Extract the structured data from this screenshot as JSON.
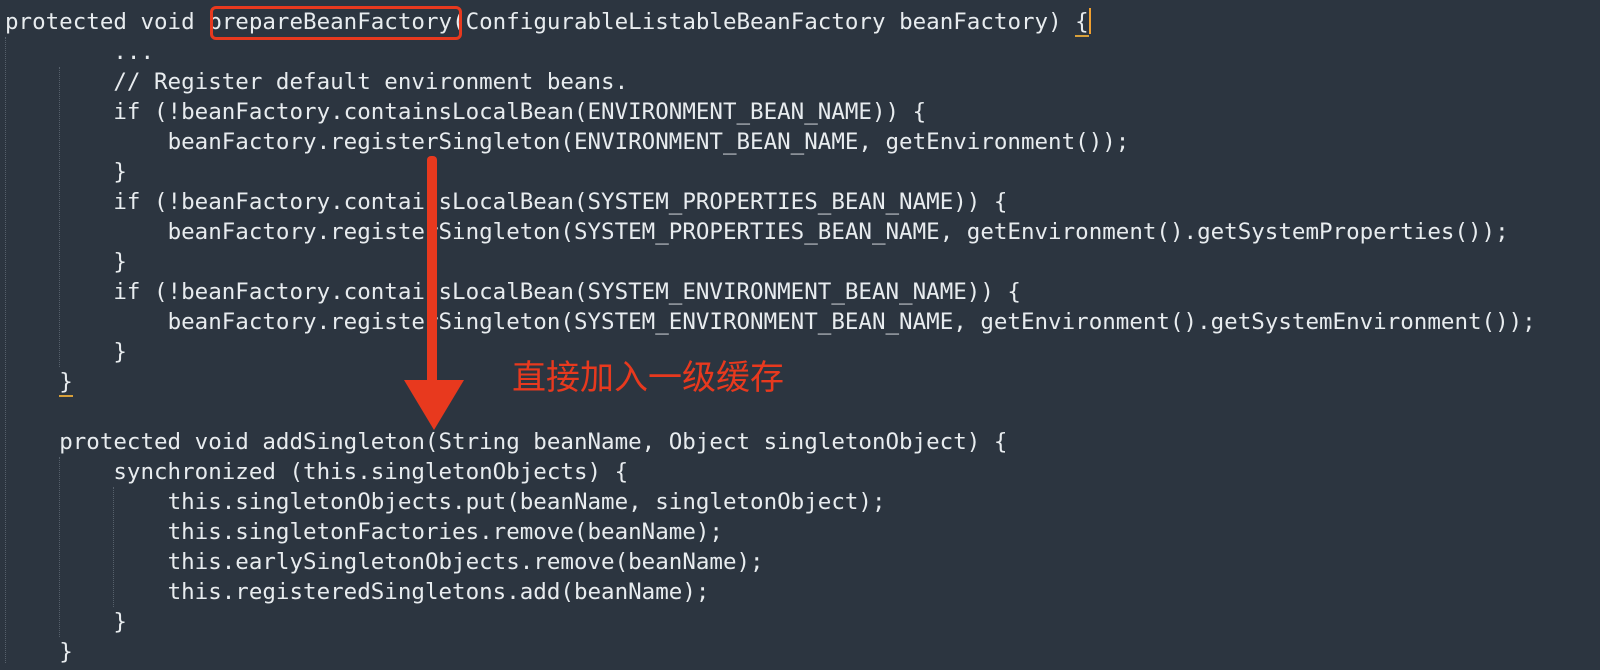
{
  "code_lines": [
    {
      "indent": "",
      "pre": "protected void ",
      "fn": "prepareBeanFactory",
      "post": "(ConfigurableListableBeanFactory beanFactory) ",
      "brace": "{"
    },
    {
      "indent": "        ",
      "text": "..."
    },
    {
      "indent": "        ",
      "text": "// Register default environment beans."
    },
    {
      "indent": "        ",
      "text": "if (!beanFactory.containsLocalBean(ENVIRONMENT_BEAN_NAME)) {"
    },
    {
      "indent": "            ",
      "text": "beanFactory.registerSingleton(ENVIRONMENT_BEAN_NAME, getEnvironment());"
    },
    {
      "indent": "        ",
      "text": "}"
    },
    {
      "indent": "        ",
      "text": "if (!beanFactory.containsLocalBean(SYSTEM_PROPERTIES_BEAN_NAME)) {"
    },
    {
      "indent": "            ",
      "text": "beanFactory.registerSingleton(SYSTEM_PROPERTIES_BEAN_NAME, getEnvironment().getSystemProperties());"
    },
    {
      "indent": "        ",
      "text": "}"
    },
    {
      "indent": "        ",
      "text": "if (!beanFactory.containsLocalBean(SYSTEM_ENVIRONMENT_BEAN_NAME)) {"
    },
    {
      "indent": "            ",
      "text": "beanFactory.registerSingleton(SYSTEM_ENVIRONMENT_BEAN_NAME, getEnvironment().getSystemEnvironment());"
    },
    {
      "indent": "        ",
      "text": "}"
    },
    {
      "indent": "    ",
      "brace": "}"
    },
    {
      "indent": "",
      "text": ""
    },
    {
      "indent": "    ",
      "text": "protected void addSingleton(String beanName, Object singletonObject) {"
    },
    {
      "indent": "        ",
      "text": "synchronized (this.singletonObjects) {"
    },
    {
      "indent": "            ",
      "text": "this.singletonObjects.put(beanName, singletonObject);"
    },
    {
      "indent": "            ",
      "text": "this.singletonFactories.remove(beanName);"
    },
    {
      "indent": "            ",
      "text": "this.earlySingletonObjects.remove(beanName);"
    },
    {
      "indent": "            ",
      "text": "this.registeredSingletons.add(beanName);"
    },
    {
      "indent": "        ",
      "text": "}"
    },
    {
      "indent": "    ",
      "text": "}"
    }
  ],
  "annotation": {
    "text": "直接加入一级缓存",
    "color": "#e8391e"
  },
  "colors": {
    "background": "#2c3540",
    "code_text": "#e8ecef",
    "highlight": "#e8391e",
    "brace_match": "#d8a03a",
    "arrow": "#e8391e"
  }
}
